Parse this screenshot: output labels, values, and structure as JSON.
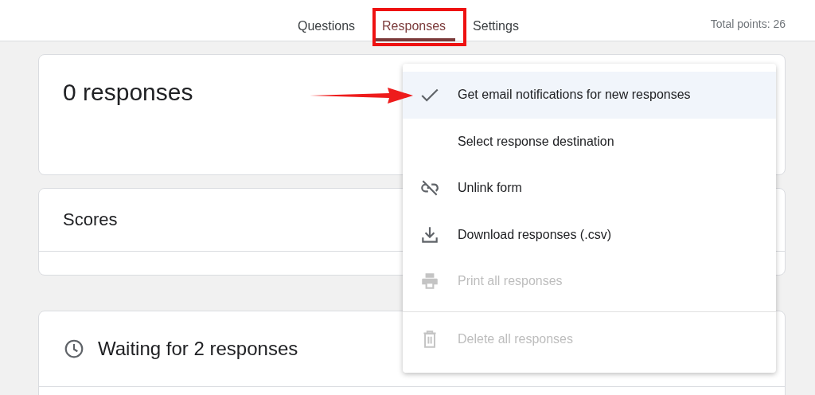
{
  "tabs": [
    {
      "label": "Questions",
      "selected": false
    },
    {
      "label": "Responses",
      "selected": true
    },
    {
      "label": "Settings",
      "selected": false
    }
  ],
  "total_points": "Total points: 26",
  "summary_card": {
    "title": "0 responses"
  },
  "scores_card": {
    "title": "Scores"
  },
  "waiting_card": {
    "title": "Waiting for 2 responses"
  },
  "menu": {
    "items": [
      {
        "kind": "check",
        "label": "Get email notifications for new responses",
        "checked": true,
        "highlighted": true,
        "disabled": false
      },
      {
        "kind": "plain",
        "label": "Select response destination",
        "highlighted": false,
        "disabled": false
      },
      {
        "kind": "unlink",
        "label": "Unlink form",
        "highlighted": false,
        "disabled": false
      },
      {
        "kind": "download",
        "label": "Download responses (.csv)",
        "highlighted": false,
        "disabled": false
      },
      {
        "kind": "print",
        "label": "Print all responses",
        "highlighted": false,
        "disabled": true
      },
      {
        "kind": "divider"
      },
      {
        "kind": "delete",
        "label": "Delete all responses",
        "highlighted": false,
        "disabled": true
      }
    ]
  }
}
